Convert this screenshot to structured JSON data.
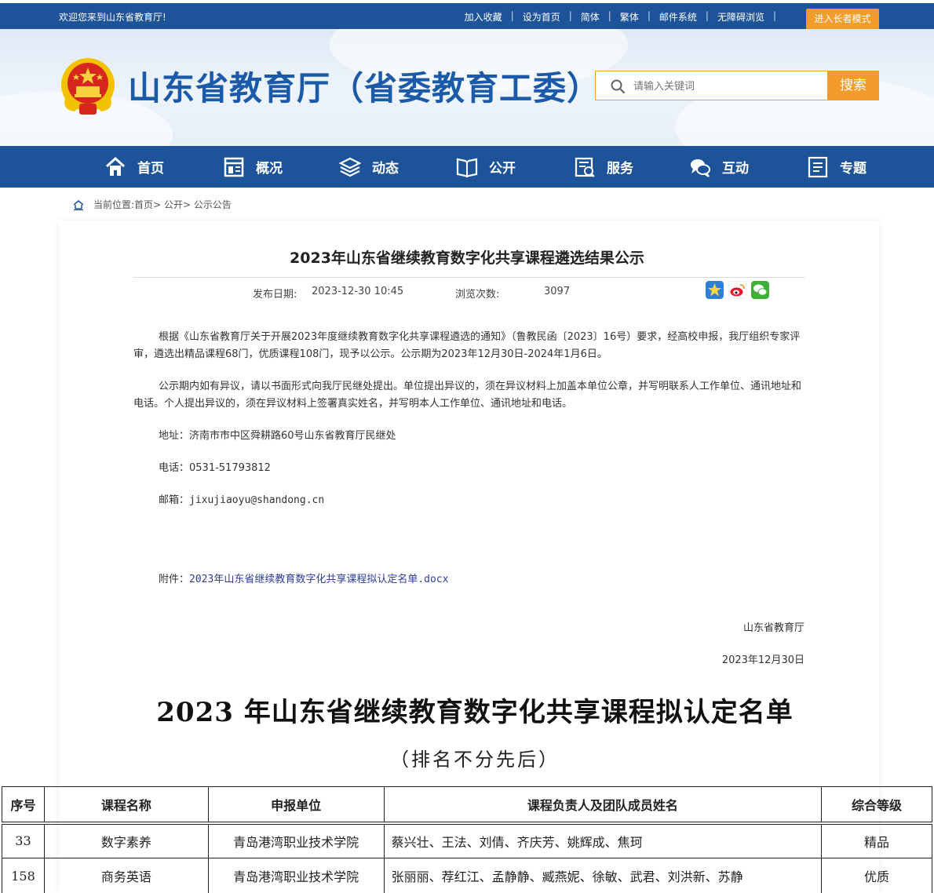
{
  "topbar": {
    "welcome": "欢迎您来到山东省教育厅!",
    "links": [
      "加入收藏",
      "设为首页",
      "简体",
      "繁体",
      "邮件系统",
      "无障碍浏览"
    ],
    "elder_mode": "进入长者模式"
  },
  "header": {
    "site_title": "山东省教育厅（省委教育工委）",
    "search_placeholder": "请输入关键词",
    "search_button": "搜索"
  },
  "nav": {
    "items": [
      {
        "label": "首页",
        "icon": "home-icon"
      },
      {
        "label": "概况",
        "icon": "overview-icon"
      },
      {
        "label": "动态",
        "icon": "news-icon"
      },
      {
        "label": "公开",
        "icon": "book-icon"
      },
      {
        "label": "服务",
        "icon": "service-icon"
      },
      {
        "label": "互动",
        "icon": "chat-icon"
      },
      {
        "label": "专题",
        "icon": "topic-icon"
      }
    ]
  },
  "breadcrumb": {
    "prefix": "当前位置:",
    "items": [
      "首页",
      "公开",
      "公示公告"
    ]
  },
  "article": {
    "title": "2023年山东省继续教育数字化共享课程遴选结果公示",
    "date_label": "发布日期:",
    "date_value": "2023-12-30 10:45",
    "views_label": "浏览次数:",
    "views_value": "3097",
    "share_icons": [
      "star-icon",
      "weibo-icon",
      "wechat-icon"
    ],
    "para1": "根据《山东省教育厅关于开展2023年度继续教育数字化共享课程遴选的通知》（鲁教民函〔2023〕16号）要求，经高校申报，我厅组织专家评审，遴选出精品课程68门，优质课程108门，现予以公示。公示期为2023年12月30日-2024年1月6日。",
    "para2": "公示期内如有异议，请以书面形式向我厅民继处提出。单位提出异议的，须在异议材料上加盖本单位公章，并写明联系人工作单位、通讯地址和电话。个人提出异议的，须在异议材料上签署真实姓名，并写明本人工作单位、通讯地址和电话。",
    "address": "地址：济南市市中区舜耕路60号山东省教育厅民继处",
    "phone": "电话：0531-51793812",
    "email": "邮箱：jixujiaoyu@shandong.cn",
    "attachment_label": "附件：",
    "attachment_link": "2023年山东省继续教育数字化共享课程拟认定名单.docx",
    "signature": "山东省教育厅",
    "sign_date": "2023年12月30日"
  },
  "document": {
    "title": "2023 年山东省继续教育数字化共享课程拟认定名单",
    "subtitle": "（排名不分先后）",
    "headers": [
      "序号",
      "课程名称",
      "申报单位",
      "课程负责人及团队成员姓名",
      "综合等级"
    ],
    "rows": [
      [
        "33",
        "数字素养",
        "青岛港湾职业技术学院",
        "蔡兴壮、王法、刘倩、齐庆芳、姚辉成、焦珂",
        "精品"
      ],
      [
        "158",
        "商务英语",
        "青岛港湾职业技术学院",
        "张丽丽、荐红江、孟静静、臧燕妮、徐敏、武君、刘洪新、苏静",
        "优质"
      ]
    ]
  }
}
